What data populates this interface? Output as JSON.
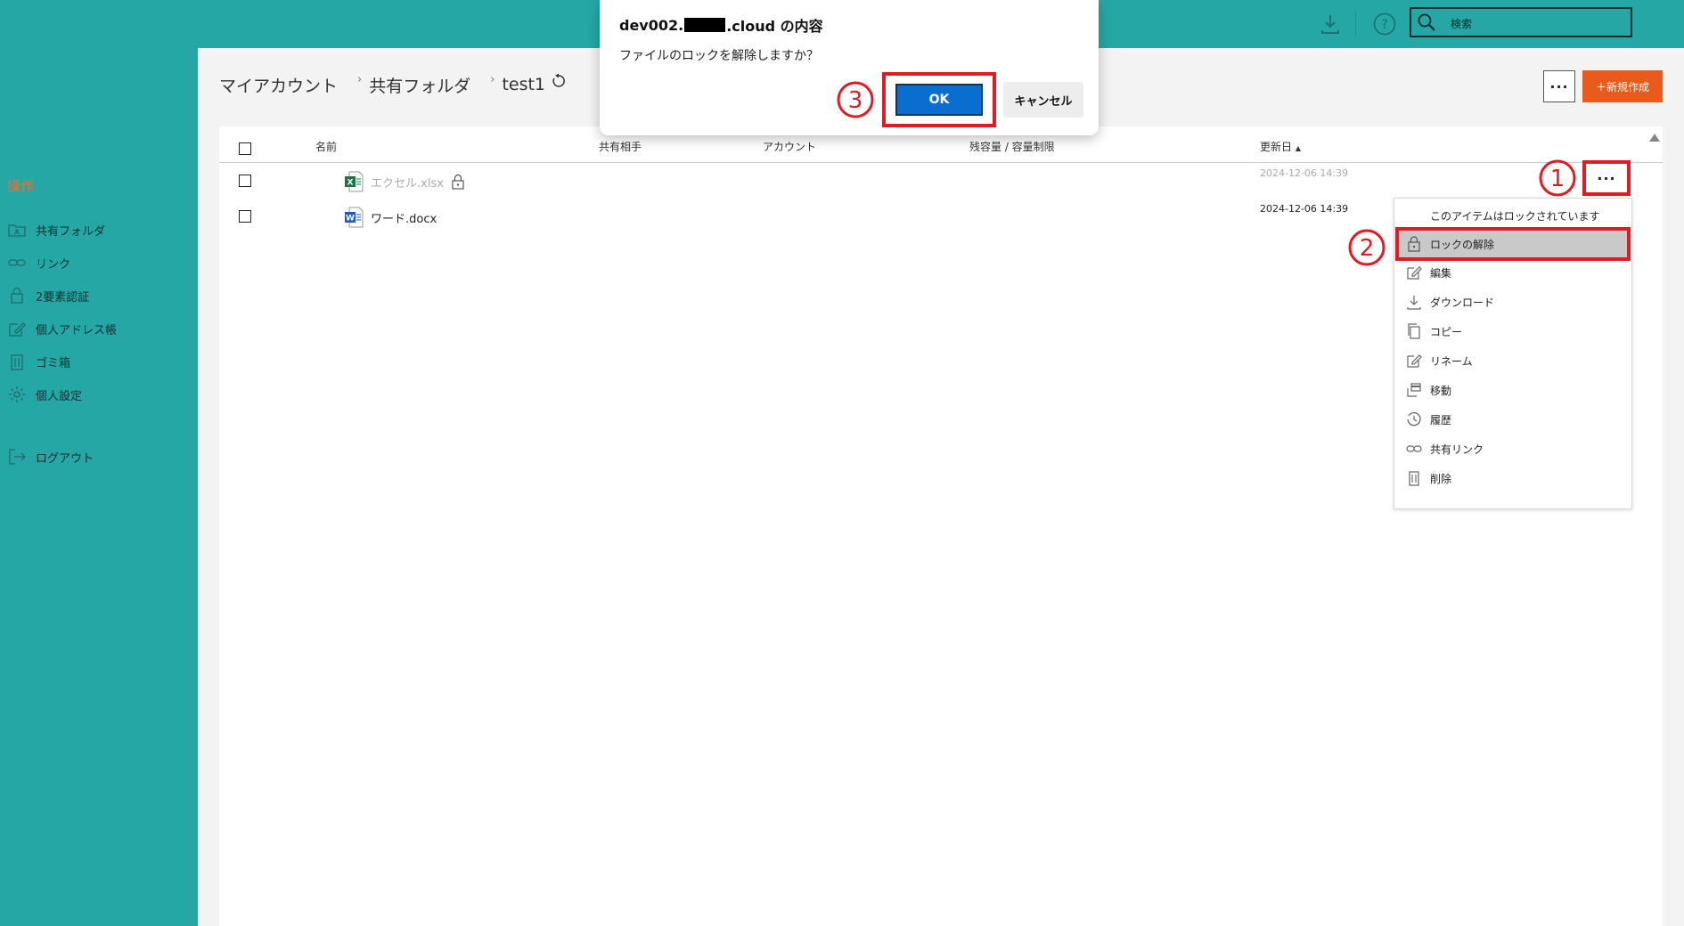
{
  "topbar": {
    "search_placeholder": "検索"
  },
  "sidebar": {
    "title": "操作",
    "items": [
      {
        "label": "共有フォルダ",
        "icon": "shared-folder-icon"
      },
      {
        "label": "リンク",
        "icon": "link-icon"
      },
      {
        "label": "2要素認証",
        "icon": "lock-icon"
      },
      {
        "label": "個人アドレス帳",
        "icon": "edit-icon"
      },
      {
        "label": "ゴミ箱",
        "icon": "trash-icon"
      },
      {
        "label": "個人設定",
        "icon": "gear-icon"
      },
      {
        "label": "ログアウト",
        "icon": "logout-icon"
      }
    ]
  },
  "breadcrumb": {
    "items": [
      "マイアカウント",
      "共有フォルダ",
      "test1"
    ]
  },
  "toolbar": {
    "more_label": "···",
    "new_label": "＋新規作成"
  },
  "table": {
    "headers": [
      "名前",
      "共有相手",
      "アカウント",
      "残容量 / 容量制限",
      "更新日"
    ],
    "sort_indicator": "▲",
    "rows": [
      {
        "name": "エクセル.xlsx",
        "type": "excel",
        "locked": true,
        "date": "2024-12-06 14:39"
      },
      {
        "name": "ワード.docx",
        "type": "word",
        "locked": false,
        "date": "2024-12-06 14:39"
      }
    ]
  },
  "row_more_label": "···",
  "context_menu": {
    "note": "このアイテムはロックされています",
    "items": [
      {
        "label": "ロックの解除",
        "icon": "unlock-icon",
        "selected": true
      },
      {
        "label": "編集",
        "icon": "edit-icon"
      },
      {
        "label": "ダウンロード",
        "icon": "download-icon"
      },
      {
        "label": "コピー",
        "icon": "copy-icon"
      },
      {
        "label": "リネーム",
        "icon": "rename-icon"
      },
      {
        "label": "移動",
        "icon": "move-icon"
      },
      {
        "label": "履歴",
        "icon": "history-icon"
      },
      {
        "label": "共有リンク",
        "icon": "link-icon"
      },
      {
        "label": "削除",
        "icon": "trash-icon"
      }
    ]
  },
  "dialog": {
    "title_prefix": "dev002.",
    "title_suffix": ".cloud の内容",
    "message": "ファイルのロックを解除しますか？",
    "ok_label": "OK",
    "cancel_label": "キャンセル"
  },
  "markers": [
    "1",
    "2",
    "3"
  ],
  "colors": {
    "accent": "#25a7a6",
    "highlight": "#e21b23",
    "primary_button": "#0a6ed1",
    "new_button": "#ea5a1a",
    "sidebar_title": "#e8732c"
  }
}
